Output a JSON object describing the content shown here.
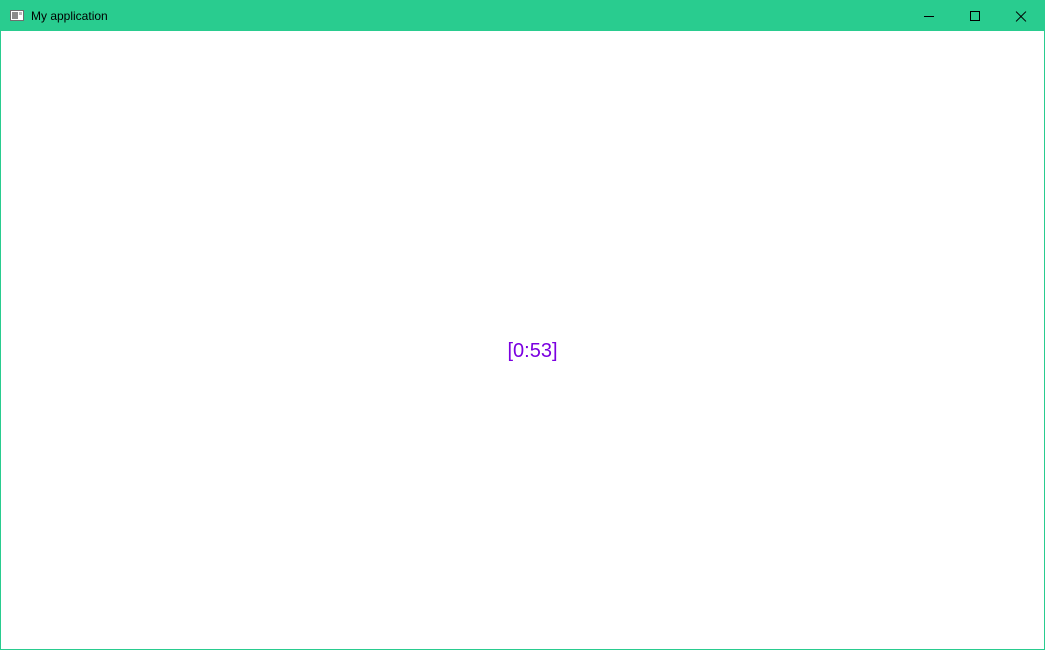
{
  "window": {
    "title": "My application",
    "accent_color": "#29cc8f",
    "controls": {
      "minimize_icon": "minimize-icon",
      "maximize_icon": "maximize-icon",
      "close_icon": "close-icon"
    }
  },
  "content": {
    "timer_text": "[0:53]",
    "timer_color": "#7b00e0"
  }
}
